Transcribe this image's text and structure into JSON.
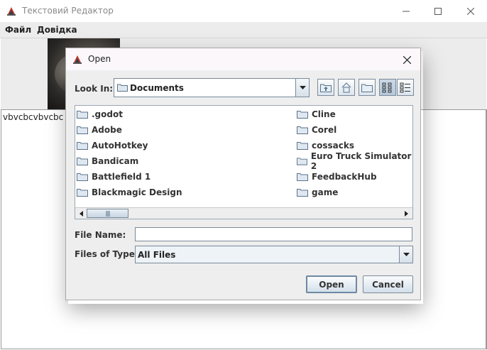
{
  "window": {
    "title": "Текстовий Редактор",
    "controls": [
      "minimize-icon",
      "maximize-icon",
      "close-icon"
    ]
  },
  "menubar": {
    "items": [
      "Файл",
      "Довідка"
    ]
  },
  "editor": {
    "text": "vbvcbcvbvcbc"
  },
  "dialog": {
    "title": "Open",
    "look_in_label": "Look In:",
    "look_in_value": "Documents",
    "toolbar_icons": [
      "up-one-level-icon",
      "home-icon",
      "new-folder-icon",
      "list-view-icon",
      "details-view-icon"
    ],
    "files_col1": [
      ".godot",
      "Adobe",
      "AutoHotkey",
      "Bandicam",
      "Battlefield 1",
      "Blackmagic Design"
    ],
    "files_col2": [
      "Cline",
      "Corel",
      "cossacks",
      "Euro Truck Simulator 2",
      "FeedbackHub",
      "game"
    ],
    "file_name_label": "File Name:",
    "file_name_value": "",
    "files_of_type_label": "Files of Type:",
    "files_of_type_value": "All Files",
    "open_button": "Open",
    "cancel_button": "Cancel"
  },
  "colors": {
    "accent": "#7a8a99",
    "dialog_bg": "#eeeeee",
    "button_gradient_bottom": "#d3dfea"
  }
}
